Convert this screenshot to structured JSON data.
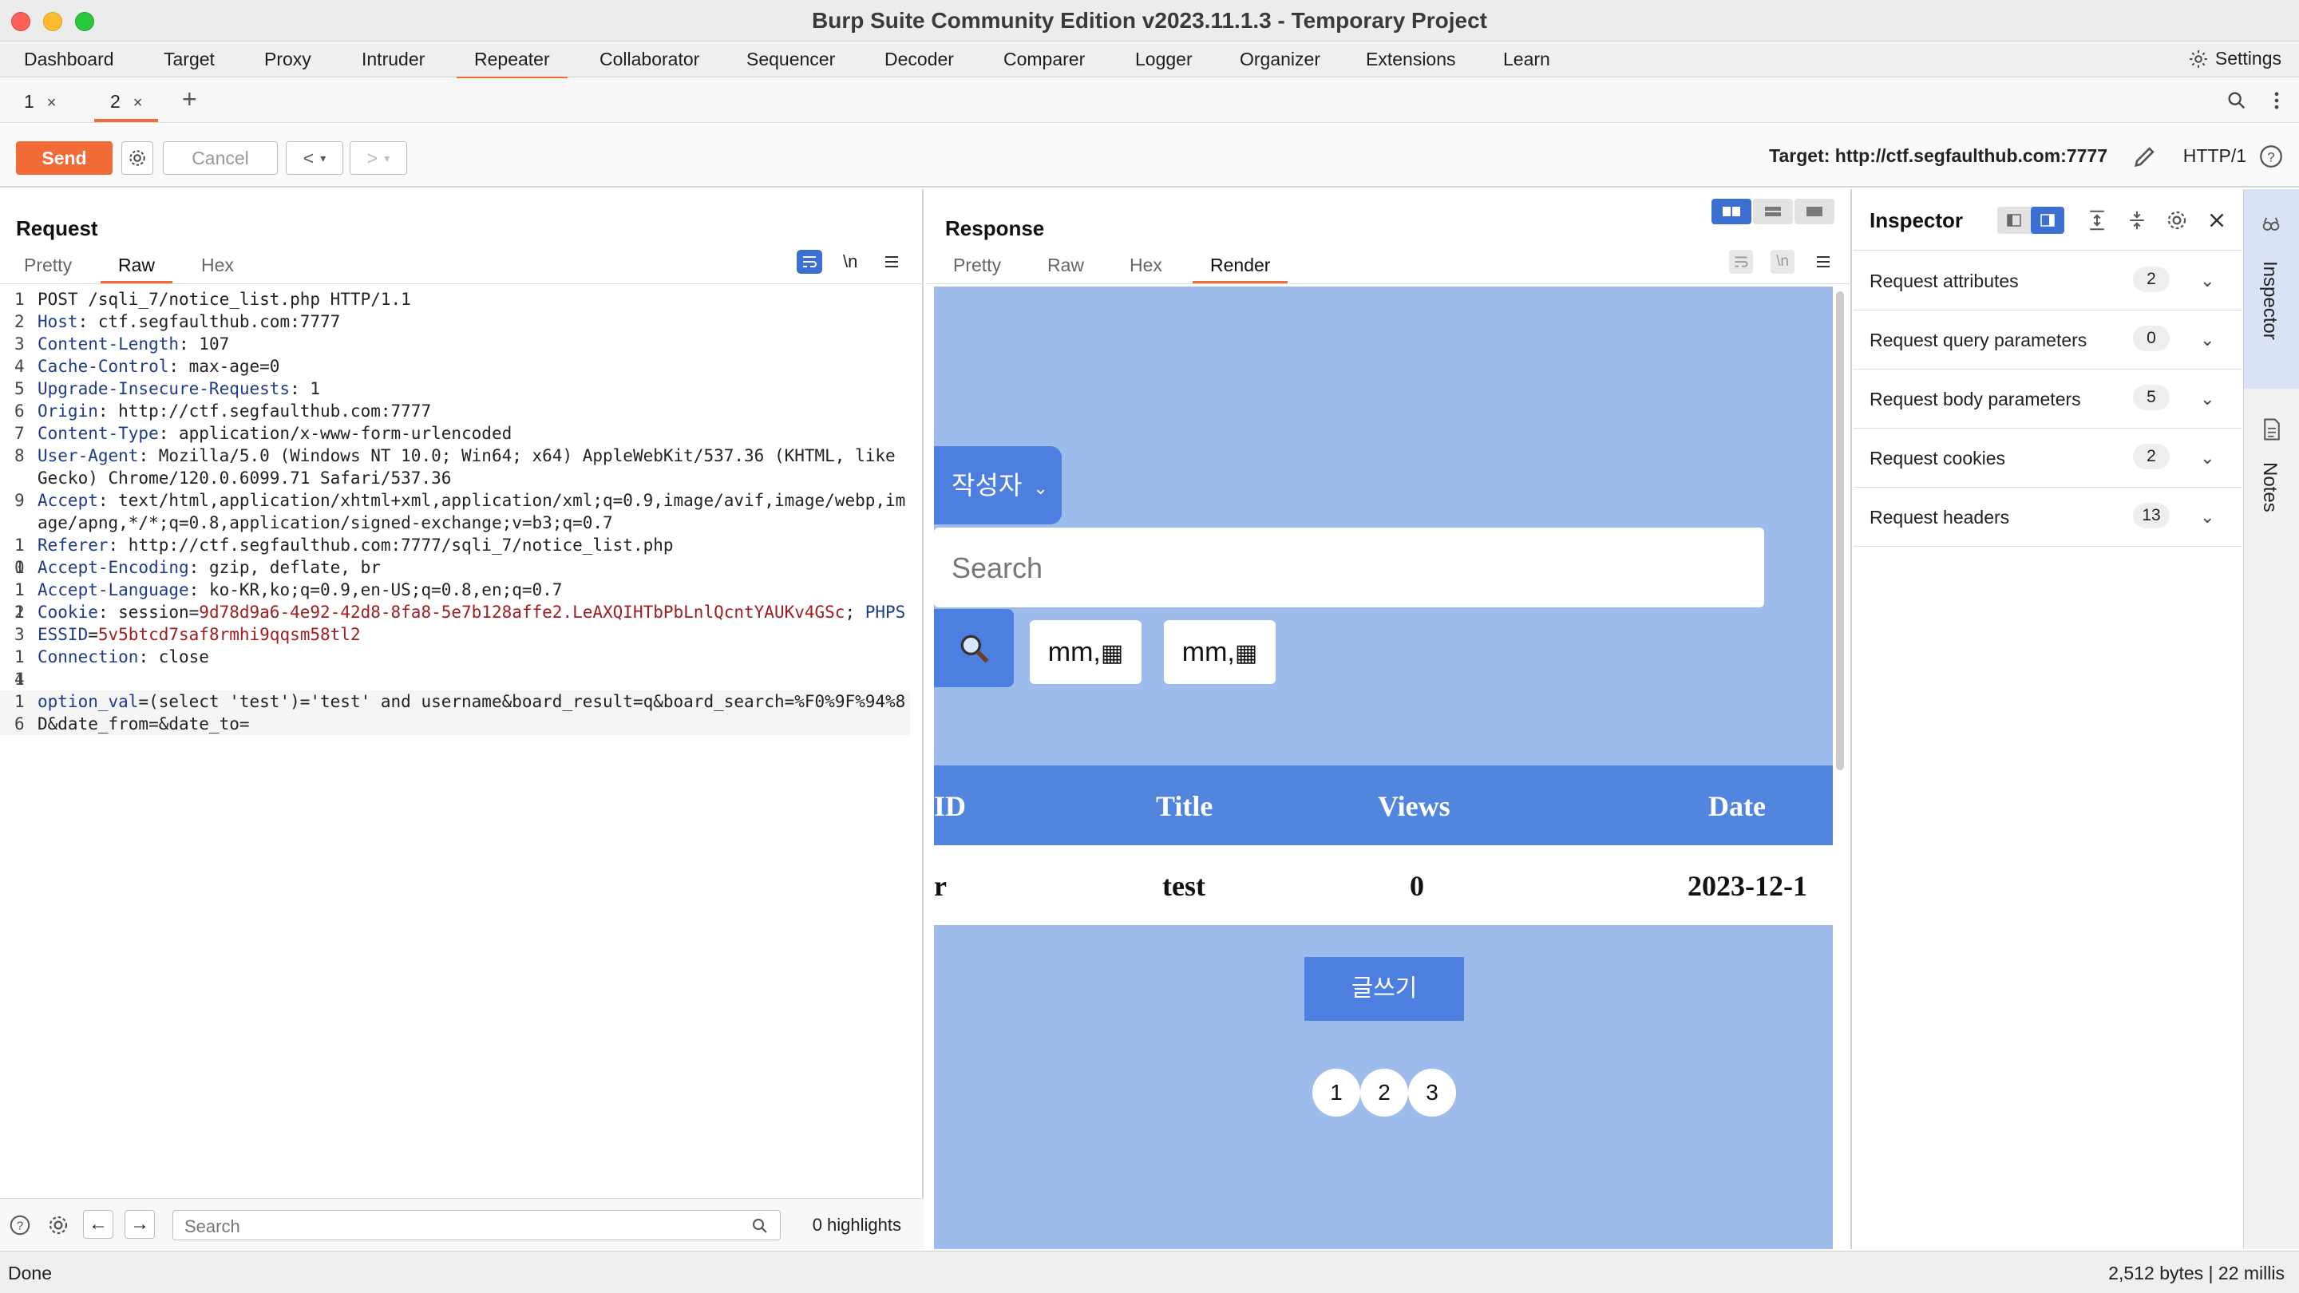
{
  "window": {
    "title": "Burp Suite Community Edition v2023.11.1.3 - Temporary Project"
  },
  "menu": [
    "Dashboard",
    "Target",
    "Proxy",
    "Intruder",
    "Repeater",
    "Collaborator",
    "Sequencer",
    "Decoder",
    "Comparer",
    "Logger",
    "Organizer",
    "Extensions",
    "Learn"
  ],
  "menu_active": "Repeater",
  "settings_label": "Settings",
  "repeater_tabs": [
    {
      "label": "1"
    },
    {
      "label": "2"
    }
  ],
  "toolbar": {
    "send": "Send",
    "cancel": "Cancel",
    "target": "Target: http://ctf.segfaulthub.com:7777",
    "http_version": "HTTP/1"
  },
  "request": {
    "title": "Request",
    "tabs": [
      "Pretty",
      "Raw",
      "Hex"
    ],
    "active_tab": "Raw",
    "newline_toggle": "\\n",
    "lines": [
      {
        "n": "1",
        "parts": [
          {
            "t": "POST /sqli_7/notice_list.php HTTP/1.1",
            "c": ""
          }
        ]
      },
      {
        "n": "2",
        "parts": [
          {
            "t": "Host",
            "c": "hk"
          },
          {
            "t": ": ctf.segfaulthub.com:7777",
            "c": ""
          }
        ]
      },
      {
        "n": "3",
        "parts": [
          {
            "t": "Content-Length",
            "c": "hk"
          },
          {
            "t": ": 107",
            "c": ""
          }
        ]
      },
      {
        "n": "4",
        "parts": [
          {
            "t": "Cache-Control",
            "c": "hk"
          },
          {
            "t": ": max-age=0",
            "c": ""
          }
        ]
      },
      {
        "n": "5",
        "parts": [
          {
            "t": "Upgrade-Insecure-Requests",
            "c": "hk"
          },
          {
            "t": ": 1",
            "c": ""
          }
        ]
      },
      {
        "n": "6",
        "parts": [
          {
            "t": "Origin",
            "c": "hk"
          },
          {
            "t": ": http://ctf.segfaulthub.com:7777",
            "c": ""
          }
        ]
      },
      {
        "n": "7",
        "parts": [
          {
            "t": "Content-Type",
            "c": "hk"
          },
          {
            "t": ": application/x-www-form-urlencoded",
            "c": ""
          }
        ]
      },
      {
        "n": "8",
        "parts": [
          {
            "t": "User-Agent",
            "c": "hk"
          },
          {
            "t": ": Mozilla/5.0 (Windows NT 10.0; Win64; x64) AppleWebKit/537.36 (KHTML, like Gecko) Chrome/120.0.6099.71 Safari/537.36",
            "c": ""
          }
        ]
      },
      {
        "n": "9",
        "parts": [
          {
            "t": "Accept",
            "c": "hk"
          },
          {
            "t": ": text/html,application/xhtml+xml,application/xml;q=0.9,image/avif,image/webp,image/apng,*/*;q=0.8,application/signed-exchange;v=b3;q=0.7",
            "c": ""
          }
        ]
      },
      {
        "n": "10",
        "parts": [
          {
            "t": "Referer",
            "c": "hk"
          },
          {
            "t": ": http://ctf.segfaulthub.com:7777/sqli_7/notice_list.php",
            "c": ""
          }
        ]
      },
      {
        "n": "11",
        "parts": [
          {
            "t": "Accept-Encoding",
            "c": "hk"
          },
          {
            "t": ": gzip, deflate, br",
            "c": ""
          }
        ]
      },
      {
        "n": "12",
        "parts": [
          {
            "t": "Accept-Language",
            "c": "hk"
          },
          {
            "t": ": ko-KR,ko;q=0.9,en-US;q=0.8,en;q=0.7",
            "c": ""
          }
        ]
      },
      {
        "n": "13",
        "parts": [
          {
            "t": "Cookie",
            "c": "hk"
          },
          {
            "t": ": session=",
            "c": ""
          },
          {
            "t": "9d78d9a6-4e92-42d8-8fa8-5e7b128affe2.LeAXQIHTbPbLnlQcntYAUKv4GSc",
            "c": "cv"
          },
          {
            "t": "; ",
            "c": ""
          },
          {
            "t": "PHPSESSID",
            "c": "hk"
          },
          {
            "t": "=",
            "c": ""
          },
          {
            "t": "5v5btcd7saf8rmhi9qqsm58tl2",
            "c": "cv"
          }
        ]
      },
      {
        "n": "14",
        "parts": [
          {
            "t": "Connection",
            "c": "hk"
          },
          {
            "t": ": close",
            "c": ""
          }
        ]
      },
      {
        "n": "15",
        "parts": [
          {
            "t": "",
            "c": ""
          }
        ]
      },
      {
        "n": "16",
        "parts": [
          {
            "t": "option_val",
            "c": "pv"
          },
          {
            "t": "=(select 'test')='test' and username&",
            "c": ""
          },
          {
            "t": "board_result",
            "c": ""
          },
          {
            "t": "=q&board_search=%F0%9F%94%8D&date_from=&date_to=",
            "c": ""
          }
        ]
      }
    ],
    "search_placeholder": "Search",
    "highlights": "0 highlights"
  },
  "response": {
    "title": "Response",
    "tabs": [
      "Pretty",
      "Raw",
      "Hex",
      "Render"
    ],
    "active_tab": "Render",
    "render": {
      "dropdown": "작성자",
      "search_placeholder": "Search",
      "date_from": "mm,",
      "date_to": "mm,",
      "columns": [
        "ID",
        "Title",
        "Views",
        "Date"
      ],
      "row": [
        "r",
        "test",
        "0",
        "2023-12-1"
      ],
      "write_button": "글쓰기",
      "pages": [
        "1",
        "2",
        "3"
      ]
    }
  },
  "inspector": {
    "title": "Inspector",
    "rows": [
      {
        "label": "Request attributes",
        "count": "2"
      },
      {
        "label": "Request query parameters",
        "count": "0"
      },
      {
        "label": "Request body parameters",
        "count": "5"
      },
      {
        "label": "Request cookies",
        "count": "2"
      },
      {
        "label": "Request headers",
        "count": "13"
      }
    ]
  },
  "side_tabs": [
    "Inspector",
    "Notes"
  ],
  "status": {
    "left": "Done",
    "right": "2,512 bytes | 22 millis"
  },
  "colors": {
    "accent": "#f26a35",
    "render_bg": "#9dbcec",
    "render_blue": "#4d7fe0"
  }
}
